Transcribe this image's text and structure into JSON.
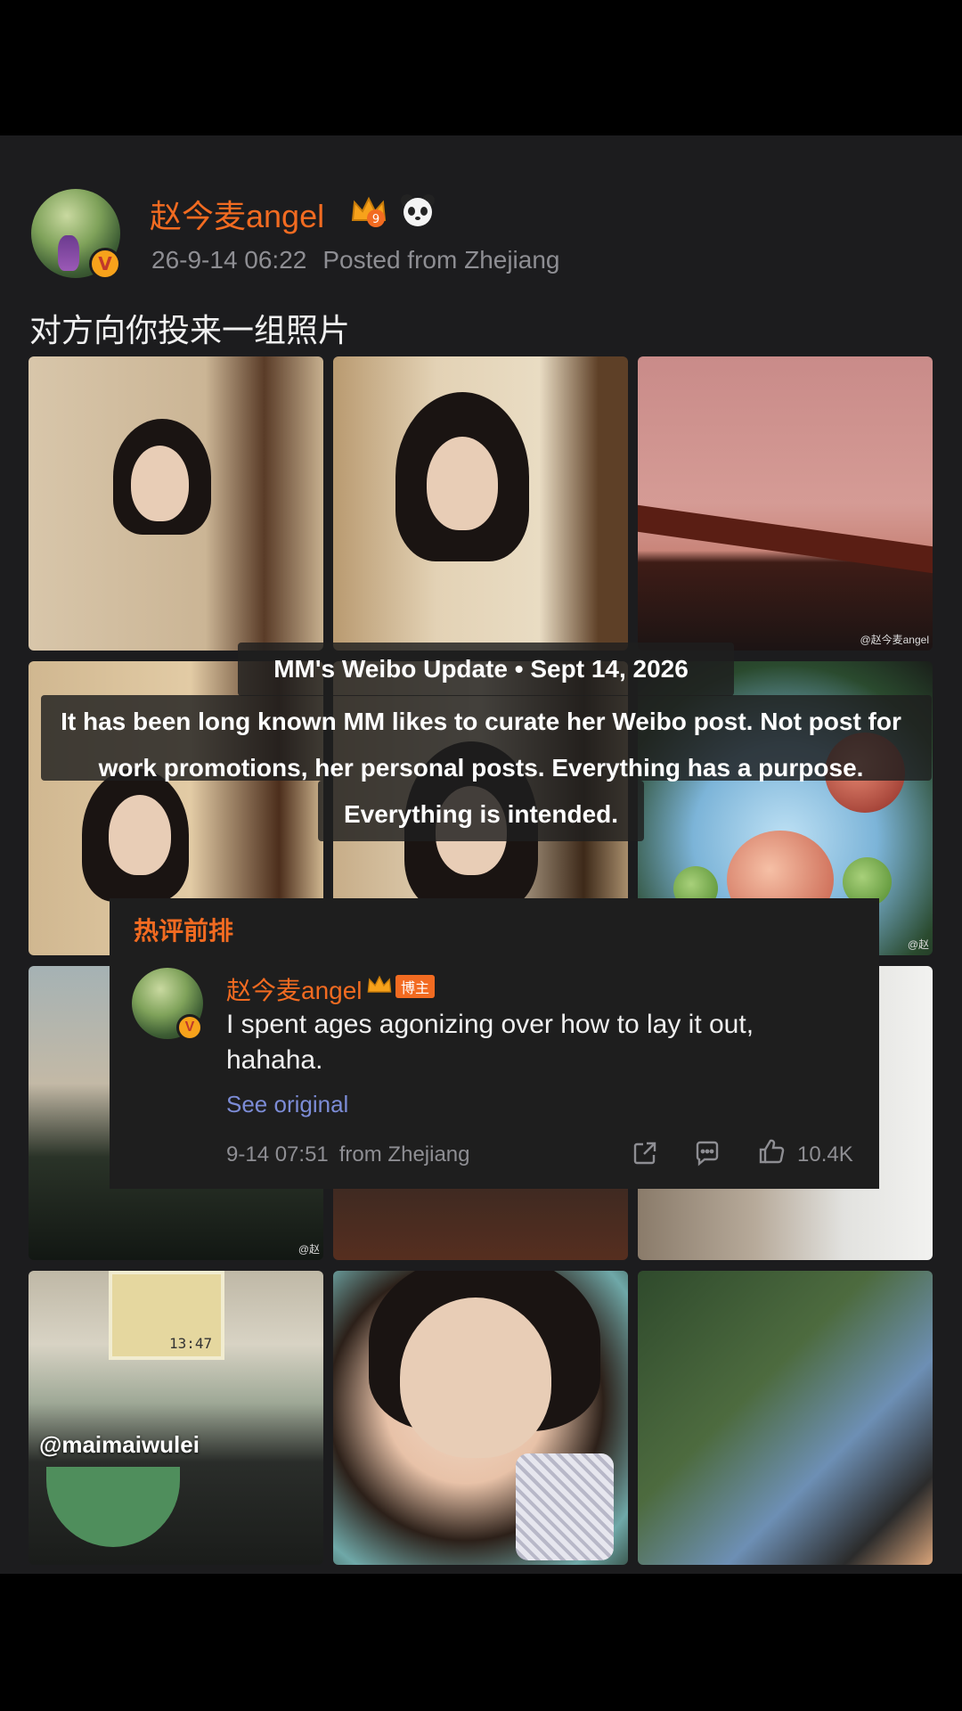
{
  "post": {
    "username": "赵今麦angel",
    "timestamp": "26-9-14 06:22",
    "location": "Posted from Zhejiang",
    "text": "对方向你投来一组照片",
    "verified_badge": "V",
    "badge_icons": [
      "crown-icon",
      "panda-icon"
    ]
  },
  "photos": {
    "watermark": "@赵今麦angel",
    "watermark_short": "@赵",
    "caption_overlay": "@maimaiwulei",
    "clock_display": "13:47"
  },
  "overlay": {
    "title": "MM's Weibo Update • Sept 14, 2026",
    "body": "It has been long known MM likes to curate her Weibo post.  Not post for work promotions, her personal posts.  Everything has a purpose. Everything is intended."
  },
  "comment": {
    "section_label": "热评前排",
    "username": "赵今麦angel",
    "tag": "博主",
    "text": "I spent ages agonizing over how to lay it out, hahaha.",
    "see_original": "See original",
    "timestamp": "9-14 07:51",
    "location": "from Zhejiang",
    "likes": "10.4K"
  },
  "colors": {
    "background": "#1c1c1e",
    "accent_orange": "#f26b21",
    "link_blue": "#7c8cd6",
    "meta_gray": "#8e8e93"
  }
}
